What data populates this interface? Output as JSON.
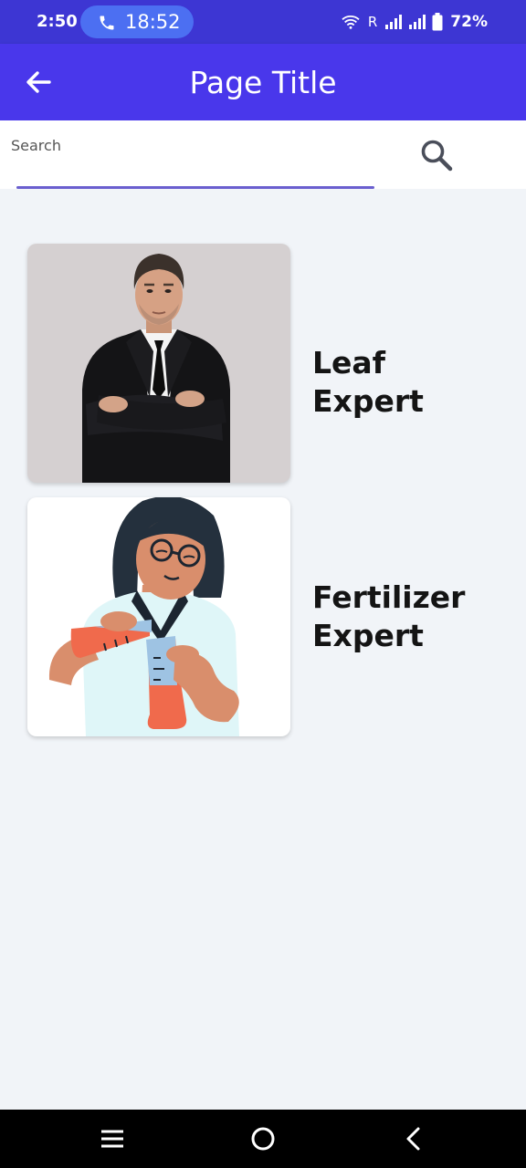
{
  "status_bar": {
    "time": "2:50",
    "call_duration": "18:52",
    "roaming_label": "R",
    "battery_percent": "72%",
    "icons": [
      "phone-icon",
      "wifi-icon",
      "signal-icon",
      "battery-icon"
    ]
  },
  "app_bar": {
    "title": "Page Title",
    "background_color": "#4937eb",
    "back_icon": "arrow-left-icon"
  },
  "search": {
    "label": "Search",
    "value": "",
    "icon": "search-icon",
    "underline_color": "#6a5fcf"
  },
  "experts": [
    {
      "name": "Leaf Expert",
      "image": "businessman-photo"
    },
    {
      "name": "Fertilizer Expert",
      "image": "scientist-illustration"
    }
  ],
  "nav_bar": {
    "buttons": [
      "menu-icon",
      "home-icon",
      "back-icon"
    ]
  }
}
